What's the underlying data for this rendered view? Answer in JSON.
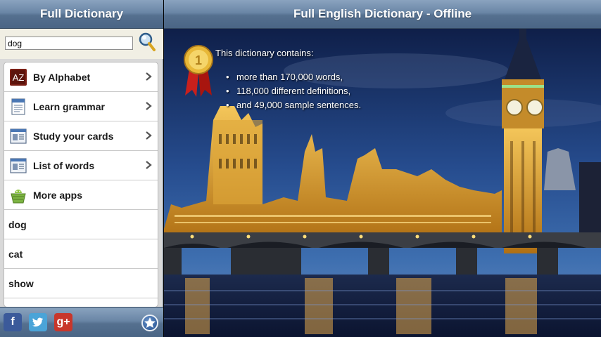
{
  "left_header": {
    "title": "Full Dictionary"
  },
  "search": {
    "value": "dog"
  },
  "menu": [
    {
      "id": "alphabet",
      "label": "By Alphabet",
      "icon": "alphabet-az-icon"
    },
    {
      "id": "grammar",
      "label": "Learn grammar",
      "icon": "grammar-book-icon"
    },
    {
      "id": "cards",
      "label": "Study your cards",
      "icon": "flashcards-icon"
    },
    {
      "id": "words",
      "label": "List of words",
      "icon": "word-list-icon"
    },
    {
      "id": "more",
      "label": "More apps",
      "icon": "android-basket-icon"
    }
  ],
  "words": [
    "dog",
    "cat",
    "show"
  ],
  "right_header": {
    "title": "Full English Dictionary - Offline"
  },
  "info": {
    "title": "This dictionary contains:",
    "items": [
      "more than 170,000 words,",
      "118,000 different definitions,",
      "and 49,000 sample sentences."
    ]
  },
  "bottom_bar": {
    "icons": [
      "facebook-icon",
      "twitter-icon",
      "google-plus-icon",
      "favorite-star-icon"
    ]
  },
  "colors": {
    "header": "#5b7696",
    "panel": "#f1efe4",
    "fb": "#3b5a9a",
    "tw": "#4aa4d8",
    "gp": "#c8362b"
  }
}
